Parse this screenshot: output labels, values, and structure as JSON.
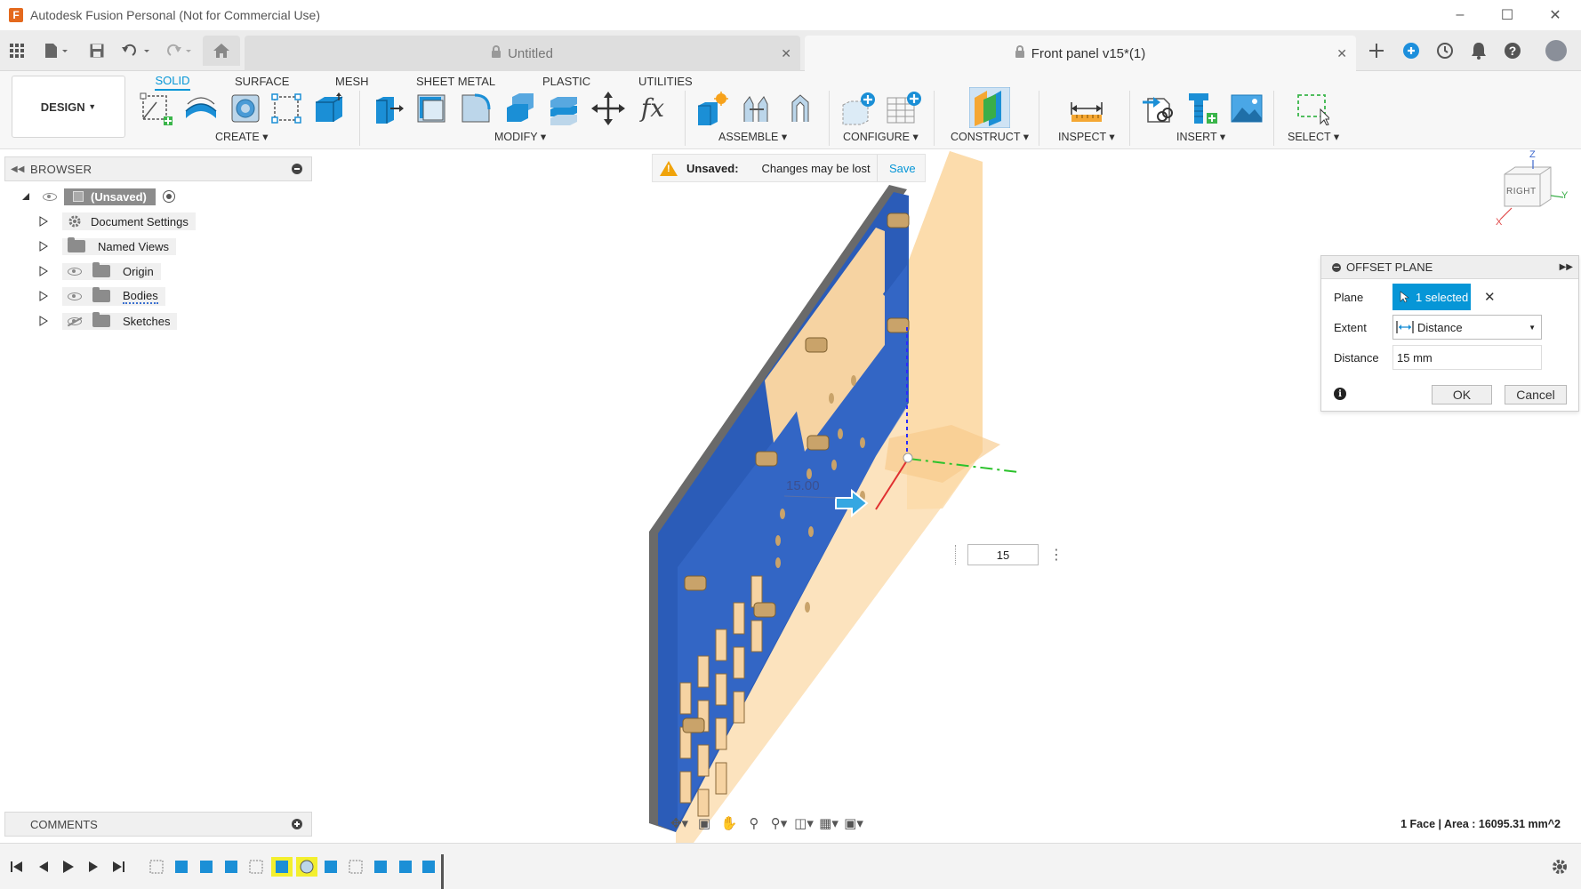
{
  "window": {
    "title": "Autodesk Fusion Personal (Not for Commercial Use)",
    "logo_letter": "F"
  },
  "tabs": [
    {
      "label": "Untitled"
    },
    {
      "label": "Front panel v15*(1)"
    }
  ],
  "ribbon": {
    "workspace": "DESIGN",
    "tabs": [
      "SOLID",
      "SURFACE",
      "MESH",
      "SHEET METAL",
      "PLASTIC",
      "UTILITIES"
    ],
    "groups": [
      "CREATE",
      "MODIFY",
      "ASSEMBLE",
      "CONFIGURE",
      "CONSTRUCT",
      "INSPECT",
      "INSERT",
      "SELECT"
    ]
  },
  "browser": {
    "title": "BROWSER",
    "root": "(Unsaved)",
    "items": [
      "Document Settings",
      "Named Views",
      "Origin",
      "Bodies",
      "Sketches"
    ]
  },
  "banner": {
    "label": "Unsaved:",
    "message": "Changes may be lost",
    "action": "Save"
  },
  "viewcube": {
    "face": "RIGHT",
    "axis_z": "Z",
    "axis_y": "Y",
    "axis_x": "X"
  },
  "viewport": {
    "dimension_label": "15.00",
    "dimension_input": "15"
  },
  "dialog": {
    "title": "OFFSET PLANE",
    "plane_label": "Plane",
    "plane_value": "1 selected",
    "extent_label": "Extent",
    "extent_value": "Distance",
    "distance_label": "Distance",
    "distance_value": "15 mm",
    "ok": "OK",
    "cancel": "Cancel"
  },
  "comments": {
    "title": "COMMENTS"
  },
  "status": "1 Face | Area : 16095.31 mm^2",
  "colors": {
    "accent": "#0696d7",
    "panel_blue": "#2a5bb5",
    "plane_orange": "#fbd9a8",
    "warning": "#f0a30a"
  }
}
